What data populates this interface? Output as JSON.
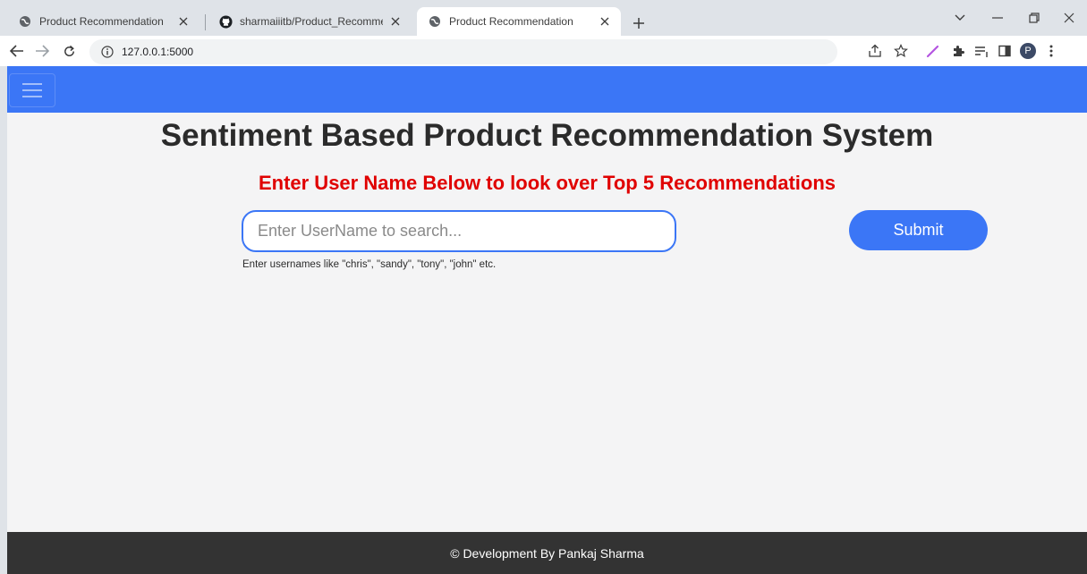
{
  "browser": {
    "tabs": [
      {
        "title": "Product Recommendation",
        "favicon": "globe-icon",
        "active": false
      },
      {
        "title": "sharmaiiitb/Product_Recommendation",
        "favicon": "github-icon",
        "active": false
      },
      {
        "title": "Product Recommendation",
        "favicon": "globe-icon",
        "active": true
      }
    ],
    "url": "127.0.0.1:5000"
  },
  "page": {
    "heading": "Sentiment Based Product Recommendation System",
    "subheading": "Enter User Name Below to look over Top 5 Recommendations",
    "search": {
      "placeholder": "Enter UserName to search...",
      "value": ""
    },
    "submit_label": "Submit",
    "hint": "Enter usernames like \"chris\", \"sandy\", \"tony\", \"john\" etc.",
    "footer": "© Development By Pankaj Sharma"
  },
  "colors": {
    "accent": "#3b76f6",
    "subheading": "#e00000",
    "footer_bg": "#333333",
    "page_bg": "#f4f4f5"
  }
}
